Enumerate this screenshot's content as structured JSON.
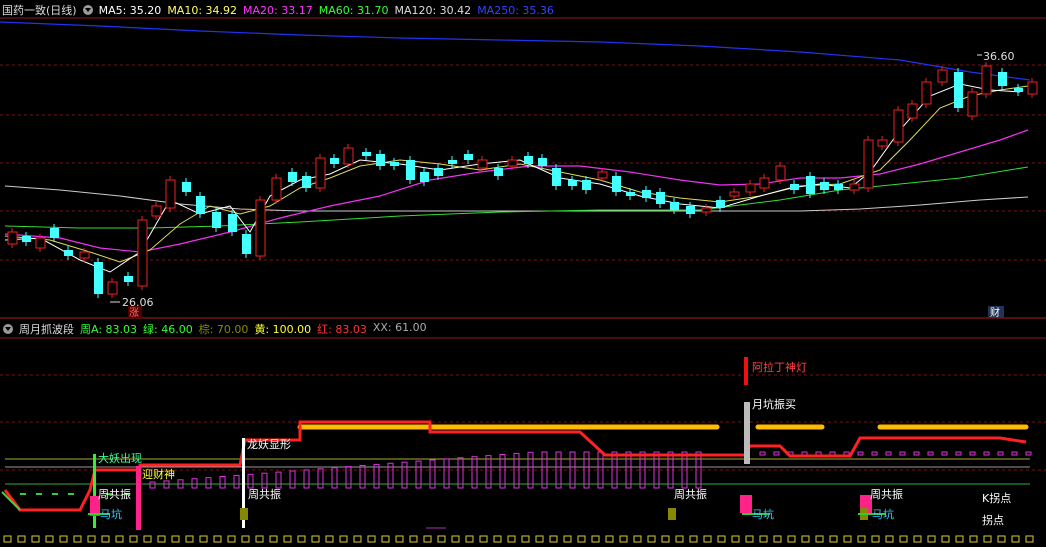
{
  "main_header": {
    "title": "国药一致(日线)",
    "ma": [
      {
        "label": "MA5: 35.20",
        "color": "#ffffff"
      },
      {
        "label": "MA10: 34.92",
        "color": "#ffff66"
      },
      {
        "label": "MA20: 33.17",
        "color": "#ff33ff"
      },
      {
        "label": "MA60: 31.70",
        "color": "#33ff33"
      },
      {
        "label": "MA120: 30.42",
        "color": "#dddddd"
      },
      {
        "label": "MA250: 35.36",
        "color": "#3344ff"
      }
    ]
  },
  "main_chart": {
    "high_label": "36.60",
    "low_label": "26.06",
    "zhang_badge": "涨",
    "cai_badge": "财"
  },
  "sub_header": {
    "title": "周月抓波段",
    "items": [
      {
        "label": "周A: 83.03",
        "color": "#33ff33"
      },
      {
        "label": "绿: 46.00",
        "color": "#33ff33"
      },
      {
        "label": "棕: 70.00",
        "color": "#888800"
      },
      {
        "label": "黄: 100.00",
        "color": "#ffff33"
      },
      {
        "label": "红: 83.03",
        "color": "#ff3333"
      },
      {
        "label": "XX: 61.00",
        "color": "#aaaaaa"
      }
    ]
  },
  "sub_chart": {
    "labels": {
      "aladdin": "阿拉丁神灯",
      "monthly_buy": "月坑振买",
      "demon_shape": "龙妖显形",
      "demon_out": "大妖出现",
      "welcome_god": "迎财神",
      "week_resonance_1": "周共振",
      "week_resonance_2": "周共振",
      "week_resonance_3": "周共振",
      "week_resonance_4": "周共振",
      "horse_pit_1": "马坑",
      "horse_pit_2": "马坑",
      "horse_pit_3": "马坑",
      "k_turn": "K拐点",
      "turn": "拐点"
    }
  }
}
